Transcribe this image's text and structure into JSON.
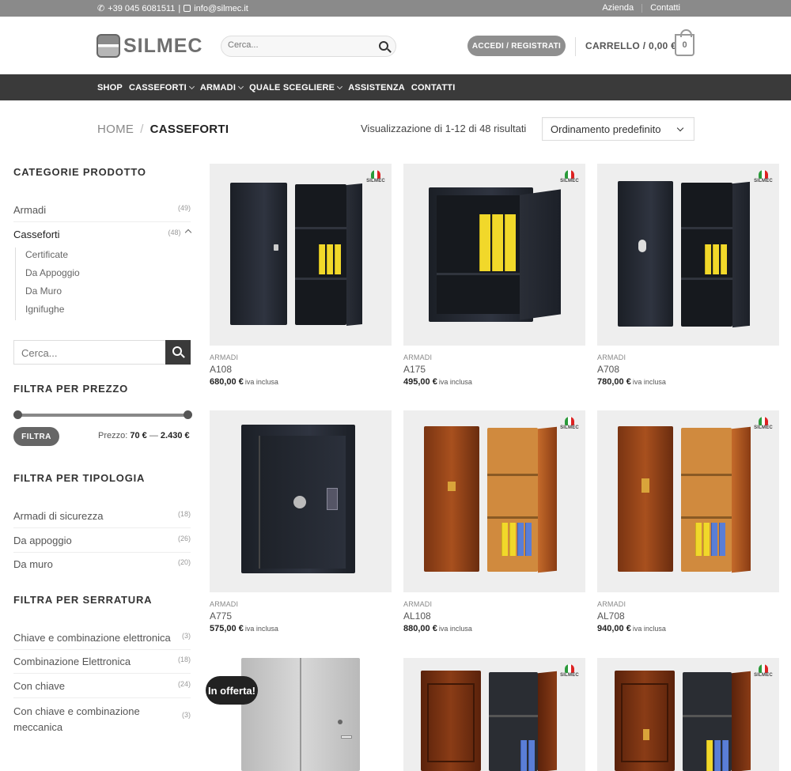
{
  "topbar": {
    "phone": "+39 045 6081511",
    "email": "info@silmec.it",
    "links": [
      "Azienda",
      "Contatti"
    ]
  },
  "header": {
    "logo_text": "SILMEC",
    "search_placeholder": "Cerca...",
    "login_label": "ACCEDI / REGISTRATI",
    "cart_label": "CARRELLO / 0,00 €",
    "cart_count": "0"
  },
  "nav": {
    "items": [
      {
        "label": "SHOP"
      },
      {
        "label": "CASSEFORTI"
      },
      {
        "label": "ARMADI"
      },
      {
        "label": "QUALE SCEGLIERE"
      },
      {
        "label": "ASSISTENZA"
      },
      {
        "label": "CONTATTI"
      }
    ]
  },
  "breadcrumb": {
    "home": "HOME",
    "sep": "/",
    "current": "CASSEFORTI"
  },
  "results_text": "Visualizzazione di 1-12 di 48 risultati",
  "sort_label": "Ordinamento predefinito",
  "sidebar": {
    "categories_title": "CATEGORIE PRODOTTO",
    "categories": [
      {
        "label": "Armadi",
        "count": "(49)"
      },
      {
        "label": "Casseforti",
        "count": "(48)"
      }
    ],
    "subcategories": [
      "Certificate",
      "Da Appoggio",
      "Da Muro",
      "Ignifughe"
    ],
    "search_placeholder": "Cerca...",
    "price_title": "FILTRA PER PREZZO",
    "filter_button": "FILTRA",
    "price_prefix": "Prezzo:",
    "price_min": "70 €",
    "price_dash": "—",
    "price_max": "2.430 €",
    "type_title": "FILTRA PER TIPOLOGIA",
    "types": [
      {
        "label": "Armadi di sicurezza",
        "count": "(18)"
      },
      {
        "label": "Da appoggio",
        "count": "(26)"
      },
      {
        "label": "Da muro",
        "count": "(20)"
      }
    ],
    "lock_title": "FILTRA PER SERRATURA",
    "locks": [
      {
        "label": "Chiave e combinazione elettronica",
        "count": "(3)"
      },
      {
        "label": "Combinazione Elettronica",
        "count": "(18)"
      },
      {
        "label": "Con chiave",
        "count": "(24)"
      },
      {
        "label": "Con chiave e combinazione meccanica",
        "count": "(3)"
      }
    ]
  },
  "brand_mark": "SILMEC",
  "products": [
    {
      "category": "ARMADI",
      "name": "A108",
      "price": "680,00 €",
      "iva": "iva inclusa"
    },
    {
      "category": "ARMADI",
      "name": "A175",
      "price": "495,00 €",
      "iva": "iva inclusa"
    },
    {
      "category": "ARMADI",
      "name": "A708",
      "price": "780,00 €",
      "iva": "iva inclusa"
    },
    {
      "category": "ARMADI",
      "name": "A775",
      "price": "575,00 €",
      "iva": "iva inclusa"
    },
    {
      "category": "ARMADI",
      "name": "AL108",
      "price": "880,00 €",
      "iva": "iva inclusa"
    },
    {
      "category": "ARMADI",
      "name": "AL708",
      "price": "940,00 €",
      "iva": "iva inclusa"
    }
  ],
  "sale_badge": "In offerta!"
}
